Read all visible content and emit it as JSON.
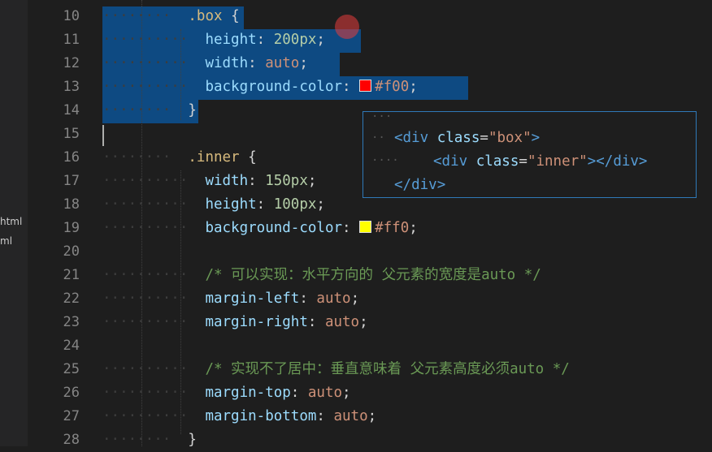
{
  "sidebar": {
    "items": [
      "html",
      "ml"
    ]
  },
  "editor": {
    "line_numbers": [
      "10",
      "11",
      "12",
      "13",
      "14",
      "15",
      "16",
      "17",
      "18",
      "19",
      "20",
      "21",
      "22",
      "23",
      "24",
      "25",
      "26",
      "27",
      "28"
    ],
    "code": {
      "l10_sel": ".box",
      "l10_brace": " {",
      "l11_prop": "height",
      "l11_colon": ": ",
      "l11_val": "200px",
      "l11_semi": ";",
      "l12_prop": "width",
      "l12_colon": ": ",
      "l12_val": "auto",
      "l12_semi": ";",
      "l13_prop": "background-color",
      "l13_colon": ": ",
      "l13_val": "#f00",
      "l13_semi": ";",
      "l14": "}",
      "l16_sel": ".inner",
      "l16_brace": " {",
      "l17_prop": "width",
      "l17_colon": ": ",
      "l17_val": "150px",
      "l17_semi": ";",
      "l18_prop": "height",
      "l18_colon": ": ",
      "l18_val": "100px",
      "l18_semi": ";",
      "l19_prop": "background-color",
      "l19_colon": ": ",
      "l19_val": "#ff0",
      "l19_semi": ";",
      "l21_comment": "/* 可以实现：水平方向的 父元素的宽度是auto */",
      "l22_prop": "margin-left",
      "l22_colon": ": ",
      "l22_val": "auto",
      "l22_semi": ";",
      "l23_prop": "margin-right",
      "l23_colon": ": ",
      "l23_val": "auto",
      "l23_semi": ";",
      "l25_comment": "/* 实现不了居中：垂直意味着 父元素高度必须auto */",
      "l26_prop": "margin-top",
      "l26_colon": ": ",
      "l26_val": "auto",
      "l26_semi": ";",
      "l27_prop": "margin-bottom",
      "l27_colon": ": ",
      "l27_val": "auto",
      "l27_semi": ";",
      "l28": "}"
    },
    "swatch_colors": {
      "red": "#ff0000",
      "yellow": "#ffff00"
    }
  },
  "popup": {
    "line1_open": "<",
    "line1_tag": "div",
    "line1_attr": "class",
    "line1_eq": "=",
    "line1_str": "\"box\"",
    "line1_close": ">",
    "line2_open": "<",
    "line2_tag": "div",
    "line2_attr": "class",
    "line2_eq": "=",
    "line2_str": "\"inner\"",
    "line2_mid": "></",
    "line2_tag2": "div",
    "line2_close": ">",
    "line3_open": "</",
    "line3_tag": "div",
    "line3_close": ">"
  },
  "colors": {
    "background": "#1e1e1e",
    "selection": "#264f78",
    "popup_border": "#2f79b8"
  }
}
